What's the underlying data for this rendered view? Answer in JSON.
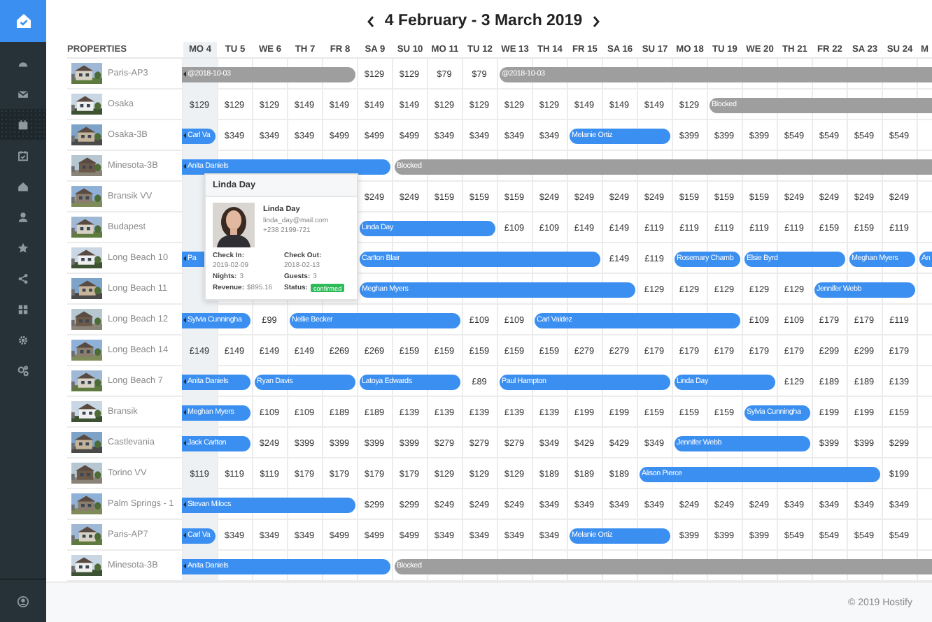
{
  "sidebar": {
    "items": [
      {
        "selected": false
      },
      {
        "selected": false
      },
      {
        "selected": true
      },
      {
        "selected": false
      },
      {
        "selected": false
      },
      {
        "selected": false
      },
      {
        "selected": false
      },
      {
        "selected": false
      },
      {
        "selected": false
      },
      {
        "selected": false
      },
      {
        "selected": false
      }
    ]
  },
  "header": {
    "title": "4 February - 3 March 2019"
  },
  "calendar": {
    "properties_label": "PROPERTIES",
    "days": [
      {
        "label": "MO 4",
        "today": true
      },
      {
        "label": "TU 5",
        "today": false
      },
      {
        "label": "WE 6",
        "today": false
      },
      {
        "label": "TH 7",
        "today": false
      },
      {
        "label": "FR 8",
        "today": false
      },
      {
        "label": "SA 9",
        "today": false
      },
      {
        "label": "SU 10",
        "today": false
      },
      {
        "label": "MO 11",
        "today": false
      },
      {
        "label": "TU 12",
        "today": false
      },
      {
        "label": "WE 13",
        "today": false
      },
      {
        "label": "TH 14",
        "today": false
      },
      {
        "label": "FR 15",
        "today": false
      },
      {
        "label": "SA 16",
        "today": false
      },
      {
        "label": "SU 17",
        "today": false
      },
      {
        "label": "MO 18",
        "today": false
      },
      {
        "label": "TU 19",
        "today": false
      },
      {
        "label": "WE 20",
        "today": false
      },
      {
        "label": "TH 21",
        "today": false
      },
      {
        "label": "FR 22",
        "today": false
      },
      {
        "label": "SA 23",
        "today": false
      },
      {
        "label": "SU 24",
        "today": false
      },
      {
        "label": "M",
        "today": false
      }
    ],
    "rows": [
      {
        "name": "Paris-AP3",
        "cells": [
          {
            "kind": "blocked",
            "label": "@2018-10-03",
            "continues": true
          },
          {
            "kind": "stay"
          },
          {
            "kind": "stay"
          },
          {
            "kind": "stay"
          },
          {
            "kind": "stay"
          },
          {
            "kind": "price",
            "text": "$129"
          },
          {
            "kind": "price",
            "text": "$129"
          },
          {
            "kind": "price",
            "text": "$79"
          },
          {
            "kind": "price",
            "text": "$79"
          },
          {
            "kind": "blocked",
            "label": "@2018-10-03",
            "continues": false
          },
          {
            "kind": "stay"
          },
          {
            "kind": "stay"
          },
          {
            "kind": "stay"
          },
          {
            "kind": "stay"
          },
          {
            "kind": "stay"
          },
          {
            "kind": "stay"
          },
          {
            "kind": "stay"
          },
          {
            "kind": "stay"
          },
          {
            "kind": "stay"
          },
          {
            "kind": "stay"
          },
          {
            "kind": "stay"
          },
          {
            "kind": "stay"
          }
        ]
      },
      {
        "name": "Osaka",
        "cells": [
          {
            "kind": "price",
            "text": "$129"
          },
          {
            "kind": "price",
            "text": "$129"
          },
          {
            "kind": "price",
            "text": "$129"
          },
          {
            "kind": "price",
            "text": "$149"
          },
          {
            "kind": "price",
            "text": "$149"
          },
          {
            "kind": "price",
            "text": "$149"
          },
          {
            "kind": "price",
            "text": "$149"
          },
          {
            "kind": "price",
            "text": "$129"
          },
          {
            "kind": "price",
            "text": "$129"
          },
          {
            "kind": "price",
            "text": "$129"
          },
          {
            "kind": "price",
            "text": "$129"
          },
          {
            "kind": "price",
            "text": "$149"
          },
          {
            "kind": "price",
            "text": "$149"
          },
          {
            "kind": "price",
            "text": "$149"
          },
          {
            "kind": "price",
            "text": "$129"
          },
          {
            "kind": "blocked",
            "label": "Blocked",
            "continues": false
          },
          {
            "kind": "stay"
          },
          {
            "kind": "stay"
          },
          {
            "kind": "stay"
          },
          {
            "kind": "stay"
          },
          {
            "kind": "stay"
          },
          {
            "kind": "stay"
          }
        ]
      },
      {
        "name": "Osaka-3B",
        "cells": [
          {
            "kind": "booking",
            "label": "Carl Va",
            "continues": true
          },
          {
            "kind": "price",
            "text": "$349"
          },
          {
            "kind": "price",
            "text": "$349"
          },
          {
            "kind": "price",
            "text": "$349"
          },
          {
            "kind": "price",
            "text": "$499"
          },
          {
            "kind": "price",
            "text": "$499"
          },
          {
            "kind": "price",
            "text": "$499"
          },
          {
            "kind": "price",
            "text": "$349"
          },
          {
            "kind": "price",
            "text": "$349"
          },
          {
            "kind": "price",
            "text": "$349"
          },
          {
            "kind": "price",
            "text": "$349"
          },
          {
            "kind": "booking",
            "label": "Melanie Ortiz",
            "continues": false
          },
          {
            "kind": "stay"
          },
          {
            "kind": "stay"
          },
          {
            "kind": "price",
            "text": "$399"
          },
          {
            "kind": "price",
            "text": "$399"
          },
          {
            "kind": "price",
            "text": "$399"
          },
          {
            "kind": "price",
            "text": "$549"
          },
          {
            "kind": "price",
            "text": "$549"
          },
          {
            "kind": "price",
            "text": "$549"
          },
          {
            "kind": "price",
            "text": "$549"
          }
        ]
      },
      {
        "name": "Minesota-3B",
        "cells": [
          {
            "kind": "booking",
            "label": "Anita Daniels",
            "continues": true
          },
          {
            "kind": "stay"
          },
          {
            "kind": "stay"
          },
          {
            "kind": "stay"
          },
          {
            "kind": "stay"
          },
          {
            "kind": "stay"
          },
          {
            "kind": "blocked",
            "label": "Blocked",
            "continues": false
          },
          {
            "kind": "stay"
          },
          {
            "kind": "stay"
          },
          {
            "kind": "stay"
          },
          {
            "kind": "stay"
          },
          {
            "kind": "stay"
          },
          {
            "kind": "stay"
          },
          {
            "kind": "stay"
          },
          {
            "kind": "stay"
          },
          {
            "kind": "stay"
          },
          {
            "kind": "stay"
          },
          {
            "kind": "stay"
          },
          {
            "kind": "stay"
          },
          {
            "kind": "stay"
          },
          {
            "kind": "stay"
          },
          {
            "kind": "stay"
          }
        ]
      },
      {
        "name": "Bransik VV",
        "cells": [
          {
            "kind": "covered"
          },
          {
            "kind": "covered"
          },
          {
            "kind": "covered"
          },
          {
            "kind": "covered"
          },
          {
            "kind": "covered"
          },
          {
            "kind": "price",
            "text": "$249"
          },
          {
            "kind": "price",
            "text": "$249"
          },
          {
            "kind": "price",
            "text": "$159"
          },
          {
            "kind": "price",
            "text": "$159"
          },
          {
            "kind": "price",
            "text": "$159"
          },
          {
            "kind": "price",
            "text": "$249"
          },
          {
            "kind": "price",
            "text": "$249"
          },
          {
            "kind": "price",
            "text": "$249"
          },
          {
            "kind": "price",
            "text": "$249"
          },
          {
            "kind": "price",
            "text": "$159"
          },
          {
            "kind": "price",
            "text": "$159"
          },
          {
            "kind": "price",
            "text": "$159"
          },
          {
            "kind": "price",
            "text": "$249"
          },
          {
            "kind": "price",
            "text": "$249"
          },
          {
            "kind": "price",
            "text": "$249"
          },
          {
            "kind": "price",
            "text": "$249"
          }
        ]
      },
      {
        "name": "Budapest",
        "cells": [
          {
            "kind": "covered"
          },
          {
            "kind": "covered"
          },
          {
            "kind": "covered"
          },
          {
            "kind": "covered"
          },
          {
            "kind": "covered"
          },
          {
            "kind": "booking",
            "label": "Linda Day",
            "continues": false
          },
          {
            "kind": "stay"
          },
          {
            "kind": "stay"
          },
          {
            "kind": "stay"
          },
          {
            "kind": "price",
            "text": "£109"
          },
          {
            "kind": "price",
            "text": "£109"
          },
          {
            "kind": "price",
            "text": "£149"
          },
          {
            "kind": "price",
            "text": "£149"
          },
          {
            "kind": "price",
            "text": "£119"
          },
          {
            "kind": "price",
            "text": "£119"
          },
          {
            "kind": "price",
            "text": "£119"
          },
          {
            "kind": "price",
            "text": "£119"
          },
          {
            "kind": "price",
            "text": "£119"
          },
          {
            "kind": "price",
            "text": "£159"
          },
          {
            "kind": "price",
            "text": "£159"
          },
          {
            "kind": "price",
            "text": "£119"
          }
        ]
      },
      {
        "name": "Long Beach 10",
        "cells": [
          {
            "kind": "booking",
            "label": "Pa",
            "continues": true
          },
          {
            "kind": "stay"
          },
          {
            "kind": "stay"
          },
          {
            "kind": "stay"
          },
          {
            "kind": "stay"
          },
          {
            "kind": "booking",
            "label": "Carlton Blair",
            "continues": false
          },
          {
            "kind": "stay"
          },
          {
            "kind": "stay"
          },
          {
            "kind": "stay"
          },
          {
            "kind": "stay"
          },
          {
            "kind": "stay"
          },
          {
            "kind": "stay"
          },
          {
            "kind": "price",
            "text": "£149"
          },
          {
            "kind": "price",
            "text": "£119"
          },
          {
            "kind": "booking",
            "label": "Rosemary Chamb",
            "continues": false
          },
          {
            "kind": "stay"
          },
          {
            "kind": "booking",
            "label": "Elsie Byrd",
            "continues": false
          },
          {
            "kind": "stay"
          },
          {
            "kind": "stay"
          },
          {
            "kind": "booking",
            "label": "Meghan Myers",
            "continues": false
          },
          {
            "kind": "stay"
          },
          {
            "kind": "booking",
            "label": "An",
            "continues": false
          }
        ]
      },
      {
        "name": "Long Beach 11",
        "cells": [
          {
            "kind": "covered"
          },
          {
            "kind": "covered"
          },
          {
            "kind": "covered"
          },
          {
            "kind": "covered"
          },
          {
            "kind": "covered"
          },
          {
            "kind": "booking",
            "label": "Meghan Myers",
            "continues": false
          },
          {
            "kind": "stay"
          },
          {
            "kind": "stay"
          },
          {
            "kind": "stay"
          },
          {
            "kind": "stay"
          },
          {
            "kind": "stay"
          },
          {
            "kind": "stay"
          },
          {
            "kind": "stay"
          },
          {
            "kind": "price",
            "text": "£129"
          },
          {
            "kind": "price",
            "text": "£129"
          },
          {
            "kind": "price",
            "text": "£129"
          },
          {
            "kind": "price",
            "text": "£129"
          },
          {
            "kind": "price",
            "text": "£129"
          },
          {
            "kind": "booking",
            "label": "Jennifer Webb",
            "continues": false
          },
          {
            "kind": "stay"
          },
          {
            "kind": "stay"
          }
        ]
      },
      {
        "name": "Long Beach 12",
        "cells": [
          {
            "kind": "booking",
            "label": "Sylvia Cunningha",
            "continues": true
          },
          {
            "kind": "stay"
          },
          {
            "kind": "price",
            "text": "£99"
          },
          {
            "kind": "booking",
            "label": "Nellie Becker",
            "continues": false
          },
          {
            "kind": "stay"
          },
          {
            "kind": "stay"
          },
          {
            "kind": "stay"
          },
          {
            "kind": "stay"
          },
          {
            "kind": "price",
            "text": "£109"
          },
          {
            "kind": "price",
            "text": "£109"
          },
          {
            "kind": "booking",
            "label": "Carl Valdez",
            "continues": false
          },
          {
            "kind": "stay"
          },
          {
            "kind": "stay"
          },
          {
            "kind": "stay"
          },
          {
            "kind": "stay"
          },
          {
            "kind": "stay"
          },
          {
            "kind": "price",
            "text": "£109"
          },
          {
            "kind": "price",
            "text": "£109"
          },
          {
            "kind": "price",
            "text": "£179"
          },
          {
            "kind": "price",
            "text": "£179"
          },
          {
            "kind": "price",
            "text": "£119"
          }
        ]
      },
      {
        "name": "Long Beach 14",
        "cells": [
          {
            "kind": "price",
            "text": "£149"
          },
          {
            "kind": "price",
            "text": "£149"
          },
          {
            "kind": "price",
            "text": "£149"
          },
          {
            "kind": "price",
            "text": "£149"
          },
          {
            "kind": "price",
            "text": "£269"
          },
          {
            "kind": "price",
            "text": "£269"
          },
          {
            "kind": "price",
            "text": "£159"
          },
          {
            "kind": "price",
            "text": "£159"
          },
          {
            "kind": "price",
            "text": "£159"
          },
          {
            "kind": "price",
            "text": "£159"
          },
          {
            "kind": "price",
            "text": "£159"
          },
          {
            "kind": "price",
            "text": "£279"
          },
          {
            "kind": "price",
            "text": "£279"
          },
          {
            "kind": "price",
            "text": "£179"
          },
          {
            "kind": "price",
            "text": "£179"
          },
          {
            "kind": "price",
            "text": "£179"
          },
          {
            "kind": "price",
            "text": "£179"
          },
          {
            "kind": "price",
            "text": "£179"
          },
          {
            "kind": "price",
            "text": "£299"
          },
          {
            "kind": "price",
            "text": "£299"
          },
          {
            "kind": "price",
            "text": "£179"
          }
        ]
      },
      {
        "name": "Long Beach 7",
        "cells": [
          {
            "kind": "booking",
            "label": "Anita Daniels",
            "continues": true
          },
          {
            "kind": "stay"
          },
          {
            "kind": "booking",
            "label": "Ryan Davis",
            "continues": false
          },
          {
            "kind": "stay"
          },
          {
            "kind": "stay"
          },
          {
            "kind": "booking",
            "label": "Latoya Edwards",
            "continues": false
          },
          {
            "kind": "stay"
          },
          {
            "kind": "stay"
          },
          {
            "kind": "price",
            "text": "£89"
          },
          {
            "kind": "booking",
            "label": "Paul Hampton",
            "continues": false
          },
          {
            "kind": "stay"
          },
          {
            "kind": "stay"
          },
          {
            "kind": "stay"
          },
          {
            "kind": "stay"
          },
          {
            "kind": "booking",
            "label": "Linda Day",
            "continues": false
          },
          {
            "kind": "stay"
          },
          {
            "kind": "stay"
          },
          {
            "kind": "price",
            "text": "£129"
          },
          {
            "kind": "price",
            "text": "£189"
          },
          {
            "kind": "price",
            "text": "£189"
          },
          {
            "kind": "price",
            "text": "£139"
          }
        ]
      },
      {
        "name": "Bransik",
        "cells": [
          {
            "kind": "booking",
            "label": "Meghan Myers",
            "continues": true
          },
          {
            "kind": "stay"
          },
          {
            "kind": "price",
            "text": "£109"
          },
          {
            "kind": "price",
            "text": "£109"
          },
          {
            "kind": "price",
            "text": "£189"
          },
          {
            "kind": "price",
            "text": "£189"
          },
          {
            "kind": "price",
            "text": "£139"
          },
          {
            "kind": "price",
            "text": "£139"
          },
          {
            "kind": "price",
            "text": "£139"
          },
          {
            "kind": "price",
            "text": "£139"
          },
          {
            "kind": "price",
            "text": "£139"
          },
          {
            "kind": "price",
            "text": "£199"
          },
          {
            "kind": "price",
            "text": "£199"
          },
          {
            "kind": "price",
            "text": "£159"
          },
          {
            "kind": "price",
            "text": "£159"
          },
          {
            "kind": "price",
            "text": "£159"
          },
          {
            "kind": "booking",
            "label": "Sylvia Cunningha",
            "continues": false
          },
          {
            "kind": "stay"
          },
          {
            "kind": "price",
            "text": "£199"
          },
          {
            "kind": "price",
            "text": "£199"
          },
          {
            "kind": "price",
            "text": "£159"
          }
        ]
      },
      {
        "name": "Castlevania",
        "cells": [
          {
            "kind": "booking",
            "label": "Jack Carlton",
            "continues": true
          },
          {
            "kind": "stay"
          },
          {
            "kind": "price",
            "text": "$249"
          },
          {
            "kind": "price",
            "text": "$399"
          },
          {
            "kind": "price",
            "text": "$399"
          },
          {
            "kind": "price",
            "text": "$399"
          },
          {
            "kind": "price",
            "text": "$399"
          },
          {
            "kind": "price",
            "text": "$279"
          },
          {
            "kind": "price",
            "text": "$279"
          },
          {
            "kind": "price",
            "text": "$279"
          },
          {
            "kind": "price",
            "text": "$349"
          },
          {
            "kind": "price",
            "text": "$429"
          },
          {
            "kind": "price",
            "text": "$429"
          },
          {
            "kind": "price",
            "text": "$349"
          },
          {
            "kind": "booking",
            "label": "Jennifer Webb",
            "continues": false
          },
          {
            "kind": "stay"
          },
          {
            "kind": "stay"
          },
          {
            "kind": "stay"
          },
          {
            "kind": "price",
            "text": "$399"
          },
          {
            "kind": "price",
            "text": "$399"
          },
          {
            "kind": "price",
            "text": "$299"
          }
        ]
      },
      {
        "name": "Torino VV",
        "cells": [
          {
            "kind": "price",
            "text": "$119"
          },
          {
            "kind": "price",
            "text": "$119"
          },
          {
            "kind": "price",
            "text": "$119"
          },
          {
            "kind": "price",
            "text": "$179"
          },
          {
            "kind": "price",
            "text": "$179"
          },
          {
            "kind": "price",
            "text": "$179"
          },
          {
            "kind": "price",
            "text": "$179"
          },
          {
            "kind": "price",
            "text": "$129"
          },
          {
            "kind": "price",
            "text": "$129"
          },
          {
            "kind": "price",
            "text": "$129"
          },
          {
            "kind": "price",
            "text": "$189"
          },
          {
            "kind": "price",
            "text": "$189"
          },
          {
            "kind": "price",
            "text": "$189"
          },
          {
            "kind": "booking",
            "label": "Alison Pierce",
            "continues": false
          },
          {
            "kind": "stay"
          },
          {
            "kind": "stay"
          },
          {
            "kind": "stay"
          },
          {
            "kind": "stay"
          },
          {
            "kind": "stay"
          },
          {
            "kind": "stay"
          },
          {
            "kind": "price",
            "text": "$199"
          }
        ]
      },
      {
        "name": "Palm Springs - 1",
        "cells": [
          {
            "kind": "booking",
            "label": "Stevan Milocs",
            "continues": true
          },
          {
            "kind": "stay"
          },
          {
            "kind": "stay"
          },
          {
            "kind": "stay"
          },
          {
            "kind": "stay"
          },
          {
            "kind": "price",
            "text": "$299"
          },
          {
            "kind": "price",
            "text": "$299"
          },
          {
            "kind": "price",
            "text": "$249"
          },
          {
            "kind": "price",
            "text": "$249"
          },
          {
            "kind": "price",
            "text": "$249"
          },
          {
            "kind": "price",
            "text": "$349"
          },
          {
            "kind": "price",
            "text": "$349"
          },
          {
            "kind": "price",
            "text": "$349"
          },
          {
            "kind": "price",
            "text": "$349"
          },
          {
            "kind": "price",
            "text": "$249"
          },
          {
            "kind": "price",
            "text": "$249"
          },
          {
            "kind": "price",
            "text": "$249"
          },
          {
            "kind": "price",
            "text": "$349"
          },
          {
            "kind": "price",
            "text": "$349"
          },
          {
            "kind": "price",
            "text": "$349"
          },
          {
            "kind": "price",
            "text": "$349"
          }
        ]
      },
      {
        "name": "Paris-AP7",
        "cells": [
          {
            "kind": "booking",
            "label": "Carl Va",
            "continues": true
          },
          {
            "kind": "price",
            "text": "$349"
          },
          {
            "kind": "price",
            "text": "$349"
          },
          {
            "kind": "price",
            "text": "$349"
          },
          {
            "kind": "price",
            "text": "$499"
          },
          {
            "kind": "price",
            "text": "$499"
          },
          {
            "kind": "price",
            "text": "$499"
          },
          {
            "kind": "price",
            "text": "$349"
          },
          {
            "kind": "price",
            "text": "$349"
          },
          {
            "kind": "price",
            "text": "$349"
          },
          {
            "kind": "price",
            "text": "$349"
          },
          {
            "kind": "booking",
            "label": "Melanie Ortiz",
            "continues": false
          },
          {
            "kind": "stay"
          },
          {
            "kind": "stay"
          },
          {
            "kind": "price",
            "text": "$399"
          },
          {
            "kind": "price",
            "text": "$399"
          },
          {
            "kind": "price",
            "text": "$399"
          },
          {
            "kind": "price",
            "text": "$549"
          },
          {
            "kind": "price",
            "text": "$549"
          },
          {
            "kind": "price",
            "text": "$549"
          },
          {
            "kind": "price",
            "text": "$549"
          }
        ]
      },
      {
        "name": "Minesota-3B",
        "cells": [
          {
            "kind": "booking",
            "label": "Anita Daniels",
            "continues": true
          },
          {
            "kind": "stay"
          },
          {
            "kind": "stay"
          },
          {
            "kind": "stay"
          },
          {
            "kind": "stay"
          },
          {
            "kind": "stay"
          },
          {
            "kind": "blocked",
            "label": "Blocked",
            "continues": false
          },
          {
            "kind": "stay"
          },
          {
            "kind": "stay"
          },
          {
            "kind": "stay"
          },
          {
            "kind": "stay"
          },
          {
            "kind": "stay"
          },
          {
            "kind": "stay"
          },
          {
            "kind": "stay"
          },
          {
            "kind": "stay"
          },
          {
            "kind": "stay"
          },
          {
            "kind": "stay"
          },
          {
            "kind": "stay"
          },
          {
            "kind": "stay"
          },
          {
            "kind": "stay"
          },
          {
            "kind": "stay"
          },
          {
            "kind": "stay"
          }
        ]
      }
    ]
  },
  "popup": {
    "title": "Linda Day",
    "name": "Linda Day",
    "email": "linda_day@mail.com",
    "phone": "+238 2199-721",
    "fields": [
      {
        "kind": "stacked",
        "label": "Check In:",
        "value": "2019-02-09"
      },
      {
        "kind": "stacked",
        "label": "Check Out:",
        "value": "2018-02-13"
      },
      {
        "kind": "inline",
        "label": "Nights:",
        "value": "3"
      },
      {
        "kind": "inline",
        "label": "Guests:",
        "value": "3"
      },
      {
        "kind": "inline",
        "label": "Revenue:",
        "value": "$895.16"
      },
      {
        "kind": "badge",
        "label": "Status:",
        "value": "confirmed"
      }
    ]
  },
  "footer": {
    "text": "© 2019 Hostify"
  }
}
